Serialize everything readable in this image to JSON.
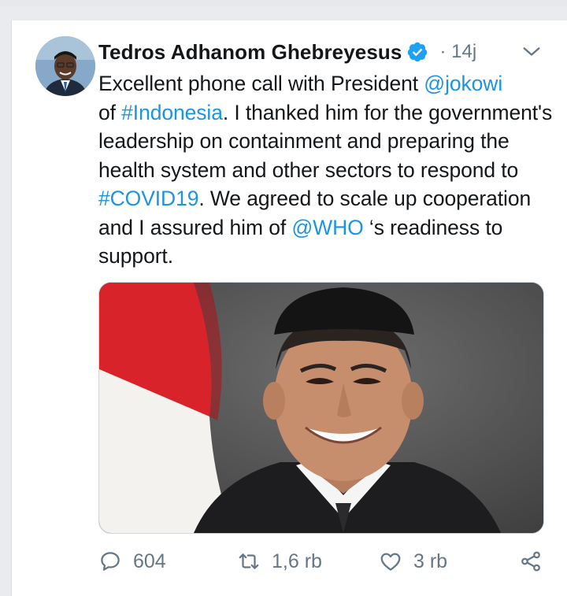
{
  "tweet": {
    "author_name": "Tedros Adhanom Ghebreyesus",
    "time": "· 14j",
    "text": [
      {
        "t": "Excellent phone call with President ",
        "link": false
      },
      {
        "t": "@jokowi",
        "link": true
      },
      {
        "t": " of ",
        "link": false
      },
      {
        "t": "#Indonesia",
        "link": true
      },
      {
        "t": ". I thanked him for the government's leadership on containment and preparing the health system and other sectors to respond to ",
        "link": false
      },
      {
        "t": "#COVID19",
        "link": true
      },
      {
        "t": ". We agreed to scale up cooperation and I assured him of ",
        "link": false
      },
      {
        "t": "@WHO",
        "link": true
      },
      {
        "t": " ‘s readiness to support.",
        "link": false
      }
    ]
  },
  "actions": {
    "replies": "604",
    "retweets": "1,6 rb",
    "likes": "3 rb"
  },
  "icons": {
    "verified": "verified-badge-icon",
    "more": "chevron-down-icon",
    "reply": "reply-icon",
    "retweet": "retweet-icon",
    "like": "heart-icon",
    "share": "share-icon"
  },
  "colors": {
    "link": "#1b95e0",
    "verified": "#1da1f2",
    "muted": "#657786",
    "text": "#14171a"
  }
}
